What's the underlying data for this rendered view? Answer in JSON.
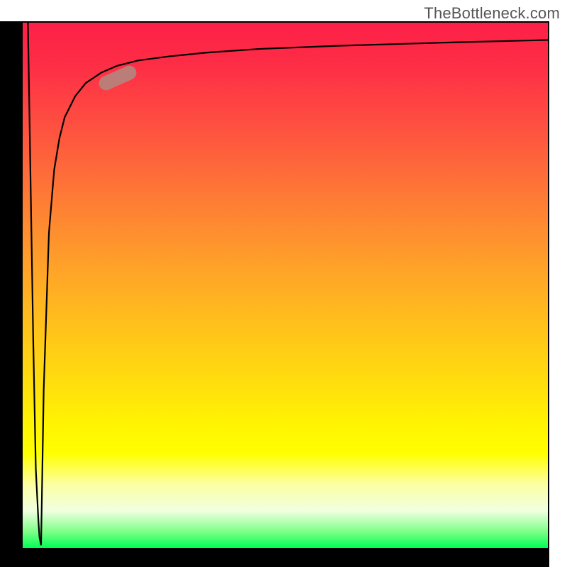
{
  "watermark": "TheBottleneck.com",
  "chart_data": {
    "type": "line",
    "title": "",
    "xlabel": "",
    "ylabel": "",
    "xlim": [
      0,
      100
    ],
    "ylim": [
      0,
      100
    ],
    "grid": false,
    "legend": false,
    "gradient_background": {
      "direction": "vertical",
      "stops": [
        {
          "pos": 0,
          "color": "#fd2047"
        },
        {
          "pos": 50,
          "color": "#ffb020"
        },
        {
          "pos": 82,
          "color": "#ffff00"
        },
        {
          "pos": 100,
          "color": "#00ff55"
        }
      ]
    },
    "series": [
      {
        "name": "spike-left",
        "x": [
          1.0,
          1.5,
          2.0,
          2.5,
          3.0,
          3.2,
          3.4,
          3.5
        ],
        "y": [
          100,
          70,
          40,
          15,
          5,
          2,
          1,
          0.5
        ],
        "color": "#000000"
      },
      {
        "name": "main-curve",
        "x": [
          3.5,
          4,
          5,
          6,
          7,
          8,
          10,
          12,
          15,
          18,
          22,
          28,
          35,
          45,
          60,
          80,
          100
        ],
        "y": [
          0.5,
          30,
          60,
          72,
          78,
          82,
          86,
          88.5,
          90.5,
          91.8,
          92.8,
          93.6,
          94.3,
          95,
          95.6,
          96.2,
          96.7
        ],
        "color": "#000000"
      }
    ],
    "annotations": [
      {
        "name": "highlight-marker",
        "shape": "capsule",
        "cx": 18,
        "cy": 89.5,
        "angle_deg": -24,
        "color": "#ba7d78"
      }
    ]
  }
}
